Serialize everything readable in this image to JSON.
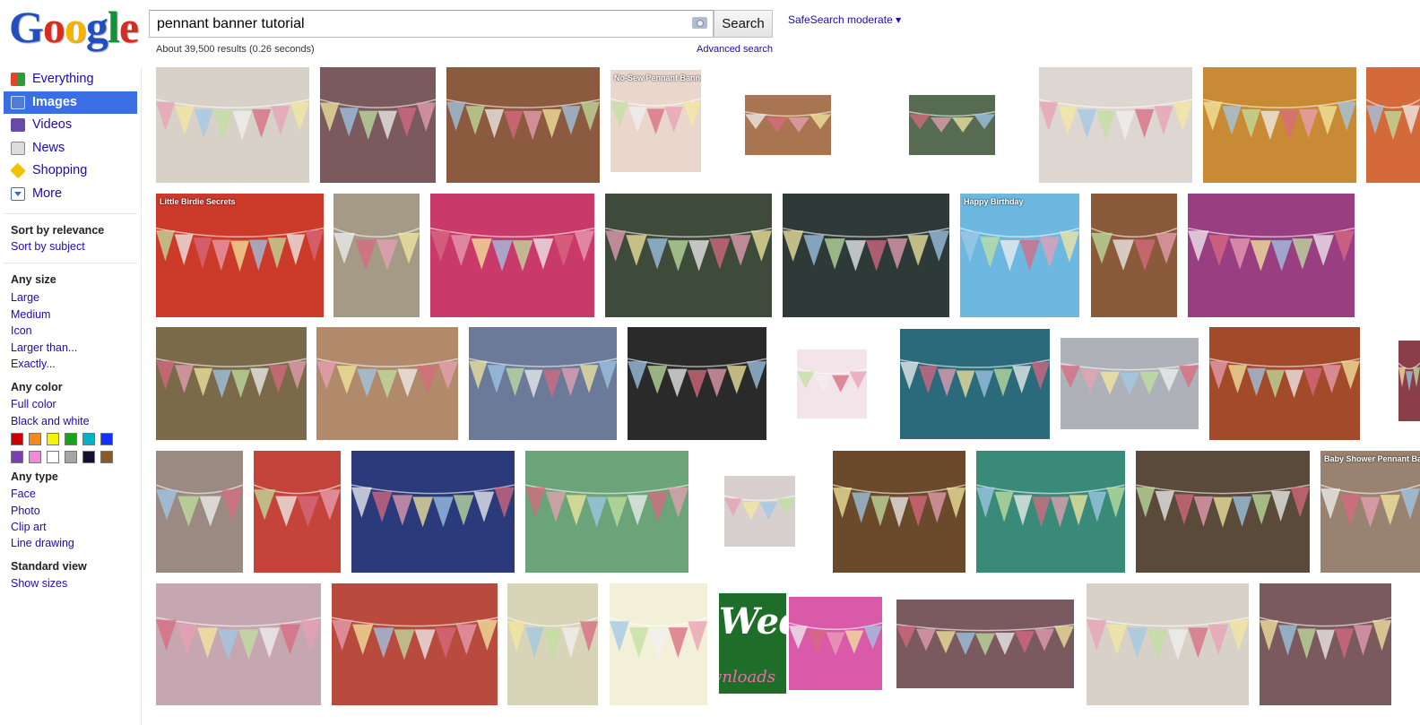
{
  "logo": {
    "text": "Google",
    "letters": [
      {
        "ch": "G",
        "color": "#1f4fc2"
      },
      {
        "ch": "o",
        "color": "#d62d20"
      },
      {
        "ch": "o",
        "color": "#f4b400"
      },
      {
        "ch": "g",
        "color": "#1f4fc2"
      },
      {
        "ch": "l",
        "color": "#11923a"
      },
      {
        "ch": "e",
        "color": "#d62d20"
      }
    ]
  },
  "search": {
    "query": "pennant banner tutorial",
    "button_label": "Search"
  },
  "safesearch": "SafeSearch moderate ▾",
  "results_stats": "About 39,500 results (0.26 seconds)",
  "advanced_search": "Advanced search",
  "sidebar": {
    "modes": [
      {
        "label": "Everything",
        "icon": "everything-icon",
        "active": false
      },
      {
        "label": "Images",
        "icon": "images-icon",
        "active": true
      },
      {
        "label": "Videos",
        "icon": "videos-icon",
        "active": false
      },
      {
        "label": "News",
        "icon": "news-icon",
        "active": false
      },
      {
        "label": "Shopping",
        "icon": "shopping-icon",
        "active": false
      },
      {
        "label": "More",
        "icon": "more-icon",
        "active": false
      }
    ],
    "sort": {
      "heading": "Sort by relevance",
      "link": "Sort by subject"
    },
    "size": {
      "heading": "Any size",
      "links": [
        "Large",
        "Medium",
        "Icon",
        "Larger than...",
        "Exactly..."
      ]
    },
    "color": {
      "heading": "Any color",
      "links": [
        "Full color",
        "Black and white"
      ],
      "swatches": [
        "#cc0000",
        "#f08a1c",
        "#f5f500",
        "#17a31a",
        "#00b4c8",
        "#1030ff",
        "#7a3fb0",
        "#f08ad8",
        "#ffffff",
        "#a6a6a6",
        "#101030",
        "#8a5a2a"
      ]
    },
    "type": {
      "heading": "Any type",
      "links": [
        "Face",
        "Photo",
        "Clip art",
        "Line drawing"
      ]
    },
    "view": {
      "heading": "Standard view",
      "link": "Show sizes"
    }
  },
  "accent_color": "#3a6fe4",
  "thumbnails": [
    {
      "bg": "#d7d1c8"
    },
    {
      "bg": "#7a5a5c"
    },
    {
      "bg": "#8c5a3e"
    },
    {
      "bg": "#e9d6cc",
      "caption": "No-Sew Pennant Banner"
    },
    {
      "bg": "#a87550"
    },
    {
      "bg": "#566b52"
    },
    {
      "bg": "#ded6d0"
    },
    {
      "bg": "#c88a34"
    },
    {
      "bg": "#d46a3a"
    },
    {
      "bg": "#cc3a2a",
      "caption": "Little Birdie Secrets"
    },
    {
      "bg": "#a59a86"
    },
    {
      "bg": "#c93a6a"
    },
    {
      "bg": "#3e4a3a"
    },
    {
      "bg": "#2e3a38"
    },
    {
      "bg": "#6cb8e0",
      "caption": "Happy Birthday"
    },
    {
      "bg": "#8a5a3a"
    },
    {
      "bg": "#9a3e82"
    },
    {
      "bg": "#7a6a4a"
    },
    {
      "bg": "#b08a6a"
    },
    {
      "bg": "#6a7a98"
    },
    {
      "bg": "#2a2a2a"
    },
    {
      "bg": "#f2e4e8"
    },
    {
      "bg": "#2a6a7a"
    },
    {
      "bg": "#aeb2b8"
    },
    {
      "bg": "#a34a2a"
    },
    {
      "bg": "#8a3e4a"
    },
    {
      "bg": "#9a8a82"
    },
    {
      "bg": "#c4443a"
    },
    {
      "bg": "#2a3a7a"
    },
    {
      "bg": "#6aa478"
    },
    {
      "bg": "#d8d0ce"
    },
    {
      "bg": "#6a4a2a"
    },
    {
      "bg": "#3a8a7a"
    },
    {
      "bg": "#5a4a3a"
    },
    {
      "bg": "#9a8270",
      "caption": "Baby Shower Pennant Banner"
    },
    {
      "bg": "#c6a6b0"
    },
    {
      "bg": "#b84a3e"
    },
    {
      "bg": "#d8d4b8"
    },
    {
      "bg": "#f2f0d8"
    },
    {
      "bg": "#1e6e2a",
      "title": "Wedding",
      "subtitle": "Downloads"
    },
    {
      "bg": "#d85aa8"
    },
    {
      "bg": "#7a5a5e"
    }
  ]
}
